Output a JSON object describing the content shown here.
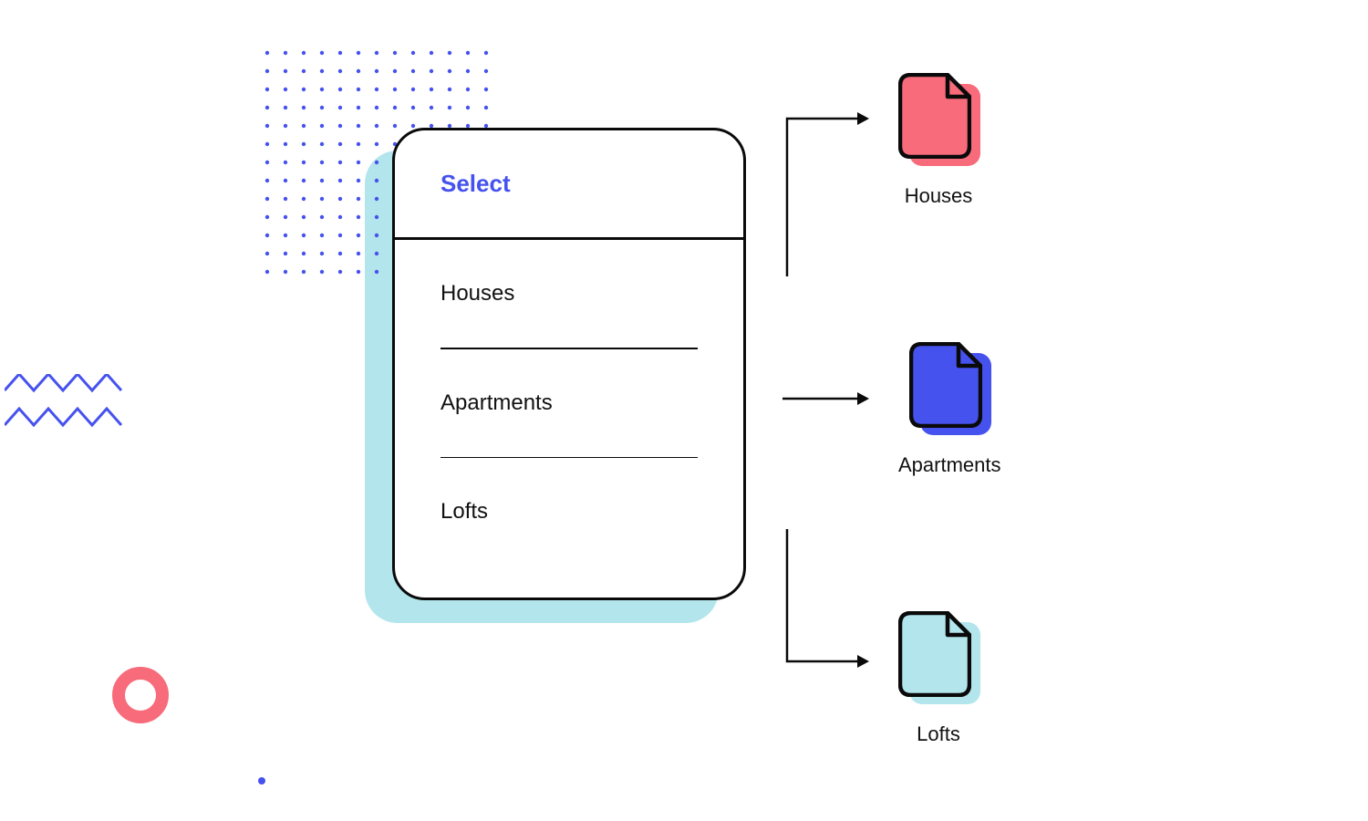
{
  "select": {
    "header": "Select",
    "options": [
      "Houses",
      "Apartments",
      "Lofts"
    ]
  },
  "targets": [
    {
      "label": "Houses",
      "color": "#f76b7a"
    },
    {
      "label": "Apartments",
      "color": "#4652ee"
    },
    {
      "label": "Lofts",
      "color": "#b3e5ed"
    }
  ],
  "colors": {
    "accent_blue": "#4652ee",
    "light_cyan": "#b3e5ed",
    "coral": "#f76b7a",
    "black": "#0a0a0a"
  }
}
